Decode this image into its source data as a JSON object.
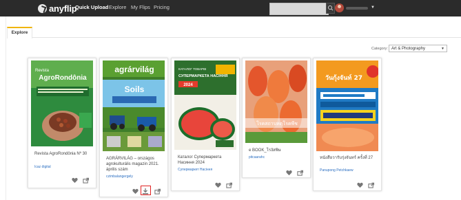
{
  "brand": {
    "name": "anyflip"
  },
  "nav": [
    {
      "label": "Quick Upload"
    },
    {
      "label": "Explore"
    },
    {
      "label": "My Flips"
    },
    {
      "label": "Pricing"
    }
  ],
  "search": {
    "placeholder": ""
  },
  "tab": {
    "label": "Explore"
  },
  "category": {
    "label": "Category:",
    "selected": "Art & Photography"
  },
  "books": [
    {
      "title": "Revista AgroRondônia Nº 30",
      "author": "Icaz digital",
      "cover_text": "AgroRondônia"
    },
    {
      "title": "AGRÁRVILÁG – országos agrokulturális magazin 2021. április szám",
      "author": "czimbalangergely",
      "cover_text": "agrárvilág"
    },
    {
      "title": "Каталог Супермаркета Насиння 2024",
      "author": "Супермаркет Насіння",
      "cover_text": "СУПЕРМАРКЕТА НАСІННЯ"
    },
    {
      "title": "e BOOK_โรงัสพิษ",
      "author": "pitcaarahc",
      "cover_text": "โรคสถาบหตุโรคพืช"
    },
    {
      "title": "หนังสือวารับรุ่งจันทร์ ครั้งที่ 27",
      "author": "Panupong Petchkaew",
      "cover_text": "วันกุ้งจันท์ 27"
    }
  ],
  "colors": {
    "topbar": "#2b2b2b",
    "accent": "#f0b400",
    "link": "#2a6ec1",
    "highlight": "#e02020"
  }
}
